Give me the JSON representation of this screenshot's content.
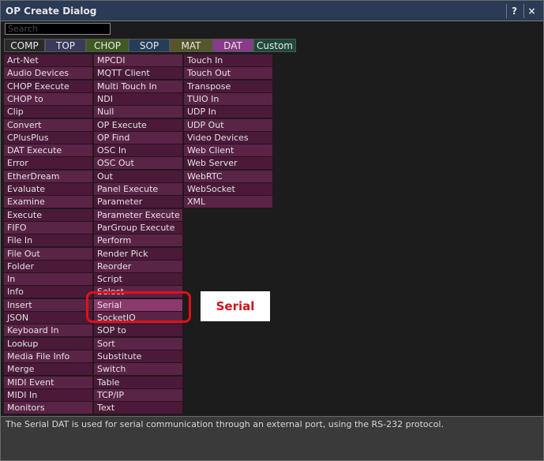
{
  "window": {
    "title": "OP Create Dialog",
    "help_label": "?",
    "close_label": "×"
  },
  "search": {
    "placeholder": "Search",
    "value": ""
  },
  "tabs": [
    {
      "label": "COMP",
      "color": "#2a2a2a"
    },
    {
      "label": "TOP",
      "color": "#3a3a5a"
    },
    {
      "label": "CHOP",
      "color": "#3e5a22"
    },
    {
      "label": "SOP",
      "color": "#243e5a"
    },
    {
      "label": "MAT",
      "color": "#56562a"
    },
    {
      "label": "DAT",
      "color": "#8a3a8a"
    },
    {
      "label": "Custom",
      "color": "#1e4a3a"
    }
  ],
  "columns": [
    [
      "Art-Net",
      "Audio Devices",
      "CHOP Execute",
      "CHOP to",
      "Clip",
      "Convert",
      "CPlusPlus",
      "DAT Execute",
      "Error",
      "EtherDream",
      "Evaluate",
      "Examine",
      "Execute",
      "FIFO",
      "File In",
      "File Out",
      "Folder",
      "In",
      "Info",
      "Insert",
      "JSON",
      "Keyboard In",
      "Lookup",
      "Media File Info",
      "Merge",
      "MIDI Event",
      "MIDI In",
      "Monitors"
    ],
    [
      "MPCDI",
      "MQTT Client",
      "Multi Touch In",
      "NDI",
      "Null",
      "OP Execute",
      "OP Find",
      "OSC In",
      "OSC Out",
      "Out",
      "Panel Execute",
      "Parameter",
      "Parameter Execute",
      "ParGroup Execute",
      "Perform",
      "Render Pick",
      "Reorder",
      "Script",
      "Select",
      "Serial",
      "SocketIO",
      "SOP to",
      "Sort",
      "Substitute",
      "Switch",
      "Table",
      "TCP/IP",
      "Text"
    ],
    [
      "Touch In",
      "Touch Out",
      "Transpose",
      "TUIO In",
      "UDP In",
      "UDP Out",
      "Video Devices",
      "Web Client",
      "Web Server",
      "WebRTC",
      "WebSocket",
      "XML"
    ]
  ],
  "highlighted": "Serial",
  "annotation": {
    "label": "Serial"
  },
  "status": {
    "text": "The Serial DAT is used for serial communication through an external port, using the RS-232 protocol."
  }
}
